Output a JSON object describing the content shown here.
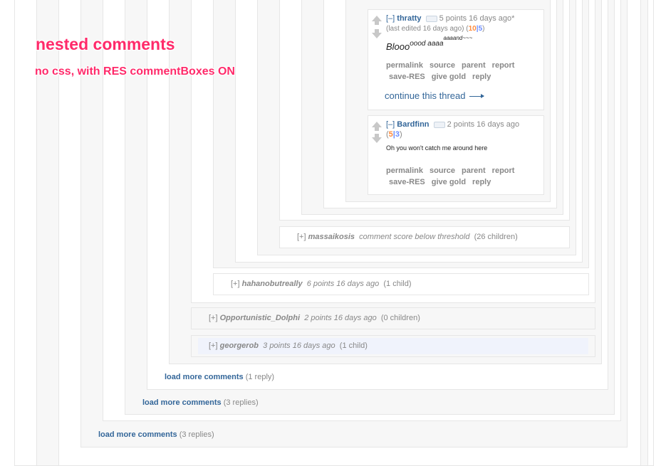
{
  "overlay": {
    "title": "nested comments",
    "subtitle": "no css, with RES commentBoxes ON"
  },
  "comments": {
    "thratty": {
      "expand": "[–]",
      "author": "thratty",
      "score": "5 points 16 days ago*",
      "edited_prefix": "(last edited 16 days ago) (",
      "up": "10",
      "sep": "|",
      "down": "5",
      "edited_suffix": ")",
      "body_main": "Blooo",
      "body_sup1": "oood aaaa",
      "body_sup2": "aaaand~~~",
      "continue_thread": "continue this thread"
    },
    "bardfinn": {
      "expand": "[–]",
      "author": "Bardfinn",
      "score": "2 points 16 days ago",
      "open": "(",
      "up": "5",
      "sep": "|",
      "down": "3",
      "close": ")",
      "body": "Oh you won't catch me around here"
    },
    "buttons": {
      "permalink": "permalink",
      "source": "source",
      "parent": "parent",
      "report": "report",
      "save_res": "save-RES",
      "give_gold": "give gold",
      "reply": "reply"
    }
  },
  "collapsed": [
    {
      "expand": "[+]",
      "author": "massaikosis",
      "info": "comment score below threshold",
      "children": "(26 children)"
    },
    {
      "expand": "[+]",
      "author": "hahanobutreally",
      "info": "6 points 16 days ago",
      "children": "(1 child)"
    },
    {
      "expand": "[+]",
      "author": "Opportunistic_Dolphi",
      "info": "2 points 16 days ago",
      "children": "(0 children)"
    },
    {
      "expand": "[+]",
      "author": "georgerob",
      "info": "3 points 16 days ago",
      "children": "(1 child)"
    }
  ],
  "load_more": [
    {
      "label": "load more comments",
      "count": "(1 reply)"
    },
    {
      "label": "load more comments",
      "count": "(3 replies)"
    },
    {
      "label": "load more comments",
      "count": "(3 replies)"
    }
  ]
}
